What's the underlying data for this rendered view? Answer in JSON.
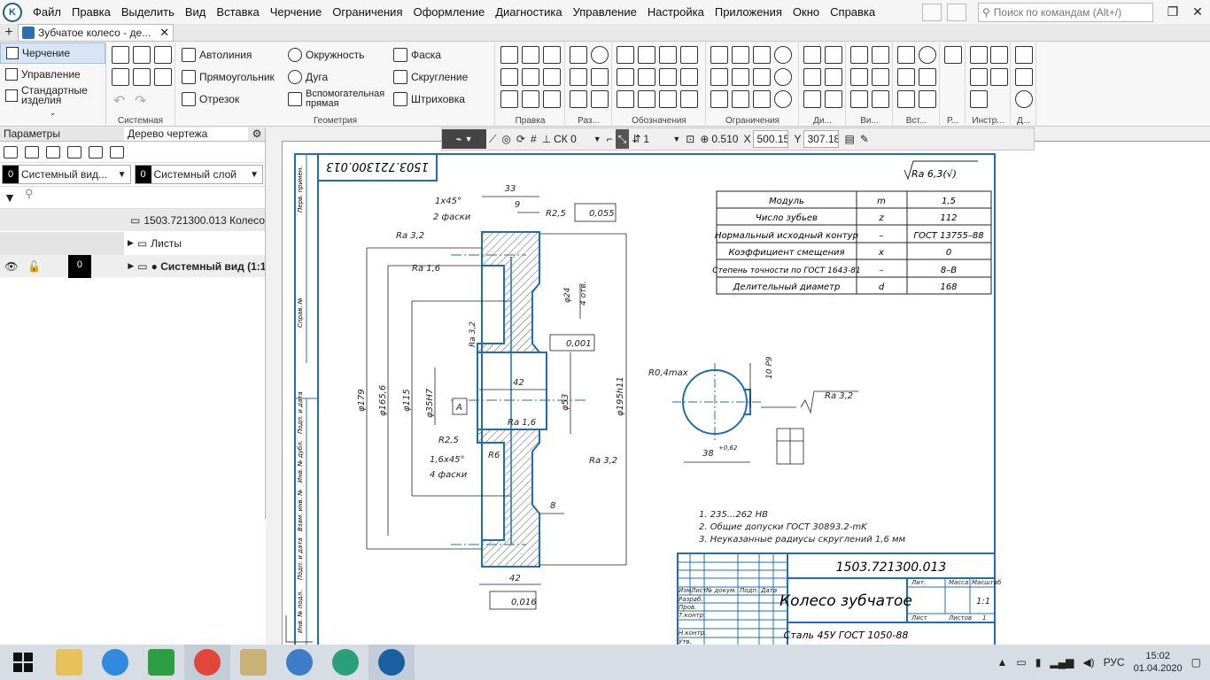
{
  "menubar": {
    "items": [
      "Файл",
      "Правка",
      "Выделить",
      "Вид",
      "Вставка",
      "Черчение",
      "Ограничения",
      "Оформление",
      "Диагностика",
      "Управление",
      "Настройка",
      "Приложения",
      "Окно",
      "Справка"
    ],
    "search_placeholder": "Поиск по командам (Alt+/)"
  },
  "tabbar": {
    "doc_tab": "Зубчатое колесо - де..."
  },
  "ribbon": {
    "modes": [
      "Черчение",
      "Управление",
      "Стандартные изделия"
    ],
    "groups": {
      "system": "Системная",
      "geometry": "Геометрия",
      "edit": "Правка",
      "size": "Раз...",
      "notation": "Обозначения",
      "constraints": "Ограничения",
      "di": "Ди...",
      "view": "Ви...",
      "insert": "Вст...",
      "r": "Р...",
      "instr": "Инстр...",
      "d": "Д..."
    },
    "geometry_buttons": [
      "Автолиния",
      "Прямоугольник",
      "Отрезок",
      "Окружность",
      "Дуга",
      "Вспомогательная прямая",
      "Фаска",
      "Скругление",
      "Штриховка"
    ]
  },
  "left_panel": {
    "tabs": [
      "Параметры",
      "Дерево чертежа"
    ],
    "view_select": {
      "badge": "0",
      "label": "Системный вид..."
    },
    "layer_select": {
      "badge": "0",
      "label": "Системный слой"
    },
    "tree": [
      {
        "label": "1503.721300.013 Колесо"
      },
      {
        "label": "Листы"
      },
      {
        "badge": "0",
        "label": "● Системный вид (1:1"
      }
    ]
  },
  "draw_toolbar": {
    "cs": "СК 0",
    "style": "1",
    "zoom": "0.510",
    "x_label": "X",
    "x": "500.154",
    "y_label": "Y",
    "y": "307.189"
  },
  "drawing": {
    "stamp_top": "1503.721300.013",
    "roughness_general": "Ra 6,3(√)",
    "table": [
      [
        "Модуль",
        "m",
        "1,5"
      ],
      [
        "Число зубьев",
        "z",
        "112"
      ],
      [
        "Нормальный исходный контур",
        "–",
        "ГОСТ 13755–88"
      ],
      [
        "Коэффициент смещения",
        "x",
        "0"
      ],
      [
        "Степень точности по ГОСТ 1643-81",
        "–",
        "8–B"
      ],
      [
        "Делительный диаметр",
        "d",
        "168"
      ]
    ],
    "dims": {
      "d33": "33",
      "d9": "9",
      "ch1": "1x45°",
      "ch1b": "2 фаски",
      "r25a": "R2,5",
      "tol1": "0,055",
      "ra32a": "Ra 3,2",
      "ra16a": "Ra 1,6",
      "d24": "φ24",
      "holes": "4 отв.",
      "ra32b": "Ra 3,2",
      "tol2": "0,001",
      "d42a": "42",
      "d179": "φ179",
      "d1656": "φ165,6",
      "d115": "φ115",
      "d35": "φ35H7",
      "d53": "φ53",
      "d195": "φ195h11",
      "baseA": "A",
      "ra16b": "Ra 1,6",
      "r25b": "R2,5",
      "ch2": "1,6x45°",
      "ch2b": "4 фаски",
      "r6": "R6",
      "ra32c": "Ra 3,2",
      "d8": "8",
      "d42b": "42",
      "tol3": "0,016",
      "r04": "R0,4max",
      "d38": "38",
      "d38t": "+0,62",
      "d10": "10 Р9",
      "ra32d": "Ra 3,2"
    },
    "notes": [
      "1. 235...262 HB",
      "2. Общие допуски ГОСТ 30893.2-mK",
      "3. Неуказанные радиусы скруглений 1,6 мм"
    ],
    "title_block": {
      "doc_no": "1503.721300.013",
      "name": "Колесо зубчатое",
      "material": "Сталь 45У ГОСТ 1050-88",
      "lit": "Лит.",
      "mass": "Масса",
      "scale": "Масштаб",
      "scale_val": "1:1",
      "sheet": "Лист",
      "sheets": "Листов",
      "sheets_val": "1",
      "rows": [
        "Изм.",
        "Лист",
        "№ докум.",
        "Подп.",
        "Дата",
        "Разраб.",
        "Пров.",
        "Т.контр.",
        "Н.контр.",
        "Утв."
      ]
    },
    "side_labels": [
      "Перв. примен.",
      "Справ. №",
      "Подп. и дата",
      "Инв. № дубл.",
      "Взам. инв. №",
      "Подп. и дата",
      "Инв. № подл."
    ]
  },
  "taskbar": {
    "apps": [
      "start",
      "explorer",
      "ie",
      "store",
      "chrome",
      "archiver",
      "audio",
      "web",
      "kompas"
    ],
    "lang": "РУС",
    "time": "15:02",
    "date": "01.04.2020"
  }
}
